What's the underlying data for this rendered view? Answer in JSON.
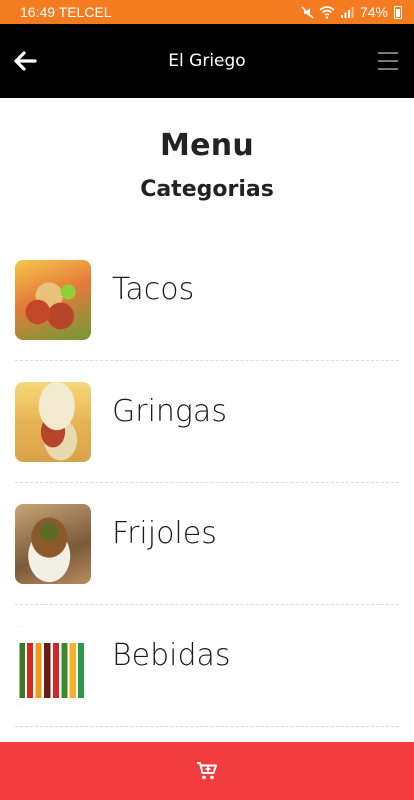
{
  "status_bar": {
    "time_carrier": "16:49 TELCEL",
    "battery_text": "74%",
    "icons": [
      "mute-icon",
      "wifi-icon",
      "signal-icon",
      "battery-icon"
    ]
  },
  "app_bar": {
    "title": "El Griego",
    "back_icon": "arrow-left-icon",
    "menu_icon": "hamburger-menu-icon"
  },
  "page": {
    "title": "Menu",
    "subtitle": "Categorias"
  },
  "categories": [
    {
      "label": "Tacos",
      "image": "tacos-photo"
    },
    {
      "label": "Gringas",
      "image": "gringas-photo"
    },
    {
      "label": "Frijoles",
      "image": "frijoles-photo"
    },
    {
      "label": "Bebidas",
      "image": "bebidas-photo"
    }
  ],
  "cart_bar": {
    "icon": "cart-plus-icon"
  },
  "colors": {
    "status_bar": "#f47c20",
    "app_bar": "#000000",
    "cart_bar": "#f23c3e"
  }
}
